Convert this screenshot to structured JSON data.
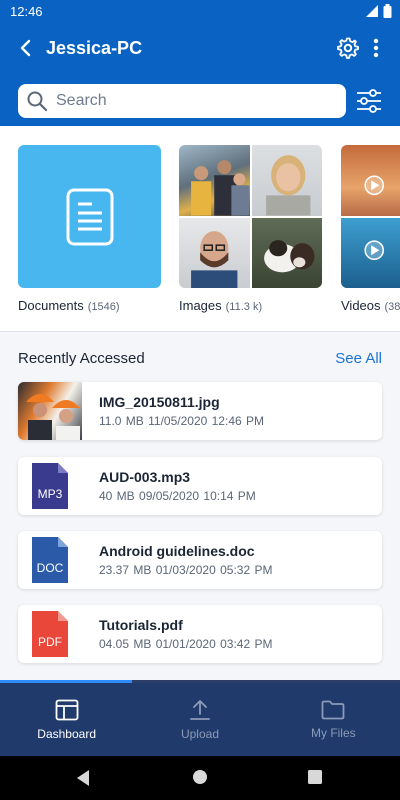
{
  "status": {
    "time": "12:46"
  },
  "appbar": {
    "title": "Jessica-PC"
  },
  "search": {
    "placeholder": "Search"
  },
  "categories": [
    {
      "label": "Documents",
      "count": "(1546)"
    },
    {
      "label": "Images",
      "count": "(11.3 k)"
    },
    {
      "label": "Videos",
      "count": "(38"
    }
  ],
  "recent": {
    "heading": "Recently Accessed",
    "see_all": "See All",
    "files": [
      {
        "name": "IMG_20150811.jpg",
        "meta": "11.0 MB   11/05/2020   12:46 PM",
        "type": "image"
      },
      {
        "name": "AUD-003.mp3",
        "meta": "40 MB   09/05/2020   10:14 PM",
        "type": "MP3"
      },
      {
        "name": "Android guidelines.doc",
        "meta": "23.37 MB   01/03/2020   05:32 PM",
        "type": "DOC"
      },
      {
        "name": "Tutorials.pdf",
        "meta": "04.05 MB   01/01/2020   03:42 PM",
        "type": "PDF"
      }
    ]
  },
  "progress": 0.33,
  "nav": [
    {
      "label": "Dashboard",
      "active": true
    },
    {
      "label": "Upload",
      "active": false
    },
    {
      "label": "My Files",
      "active": false
    }
  ],
  "colors": {
    "primary": "#0a63c2",
    "nav_bg": "#1f3a6b",
    "mp3": "#3a3a8f",
    "doc": "#2b5aa8",
    "pdf": "#e8473a",
    "doc_tile": "#48b6ef"
  }
}
